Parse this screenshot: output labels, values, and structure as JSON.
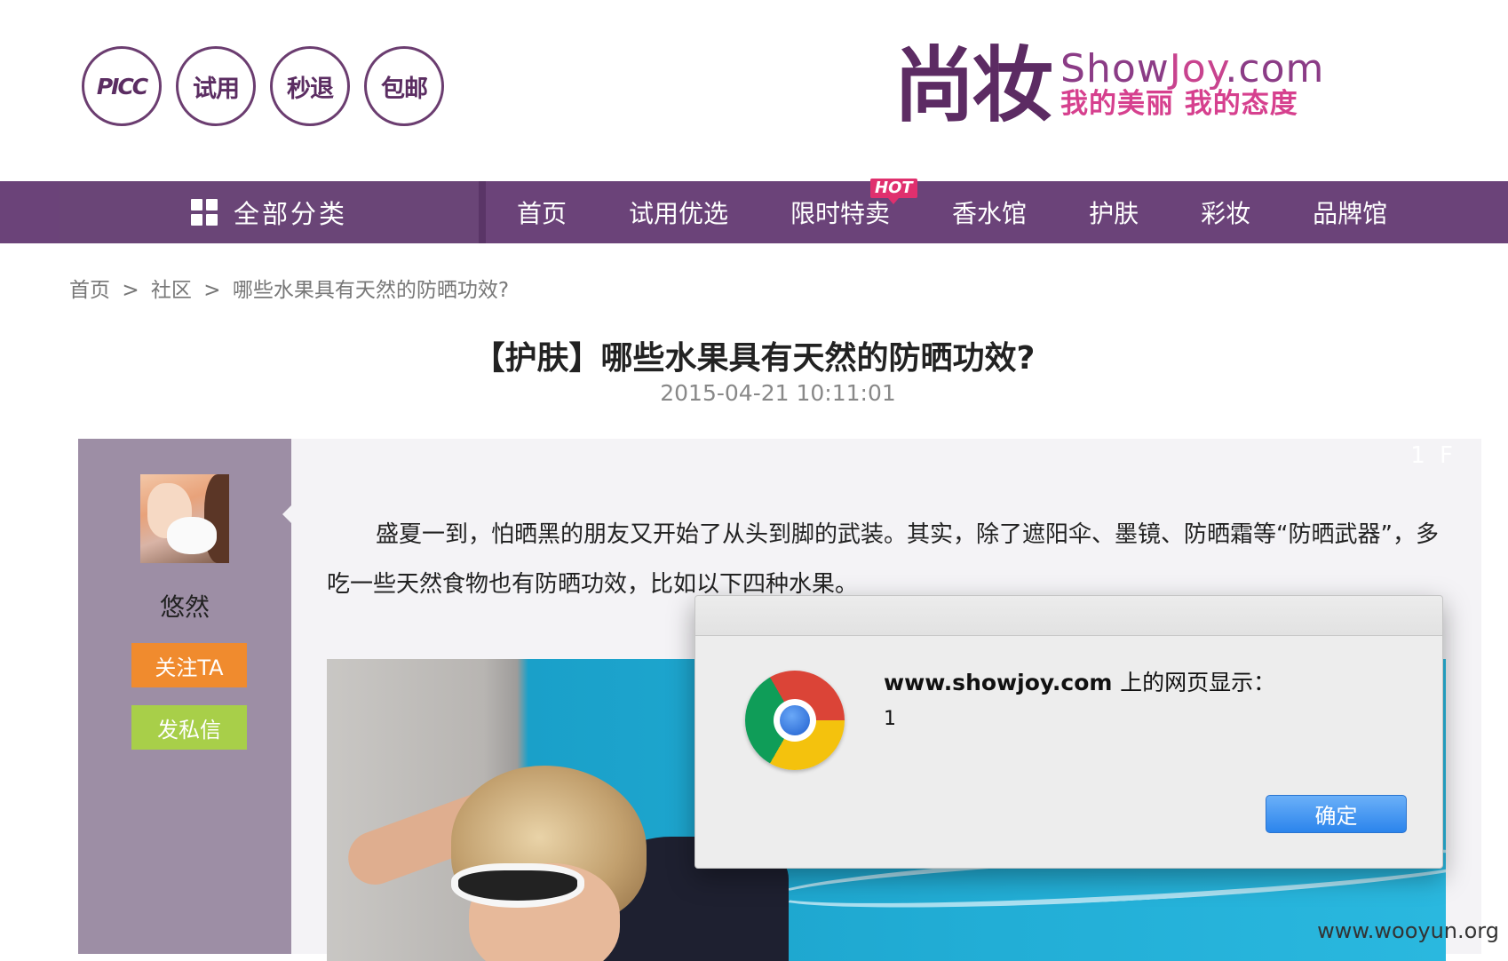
{
  "header": {
    "badges": [
      "PICC",
      "试用",
      "秒退",
      "包邮"
    ],
    "logo_cn": "尚妆",
    "logo_en_a": "Show",
    "logo_en_b": "Joy",
    "logo_en_c": ".com",
    "logo_slogan": "我的美丽 我的态度"
  },
  "nav": {
    "all_categories": "全部分类",
    "items": [
      "首页",
      "试用优选",
      "限时特卖",
      "香水馆",
      "护肤",
      "彩妆",
      "品牌馆"
    ],
    "hot_badge": "HOT"
  },
  "breadcrumb": [
    "首页",
    ">",
    "社区",
    ">",
    "哪些水果具有天然的防晒功效?"
  ],
  "post": {
    "title": "【护肤】哪些水果具有天然的防晒功效?",
    "date": "2015-04-21 10:11:01",
    "floor": "1 F",
    "author": "悠然",
    "follow_label": "关注TA",
    "message_label": "发私信",
    "body": "盛夏一到，怕晒黑的朋友又开始了从头到脚的武装。其实，除了遮阳伞、墨镜、防晒霜等“防晒武器”，多吃一些天然食物也有防晒功效，比如以下四种水果。"
  },
  "dialog": {
    "site": "www.showjoy.com",
    "heading_suffix": "上的网页显示：",
    "message": "1",
    "ok_label": "确定"
  },
  "watermark": "www.wooyun.org",
  "colors": {
    "nav_bg": "#6b4379",
    "brand_purple": "#5c2b63",
    "brand_pink": "#d6408e",
    "follow_btn": "#f08b2e",
    "message_btn": "#a8cf49",
    "hot_badge": "#e0306e",
    "dialog_button": "#2b84ec"
  }
}
